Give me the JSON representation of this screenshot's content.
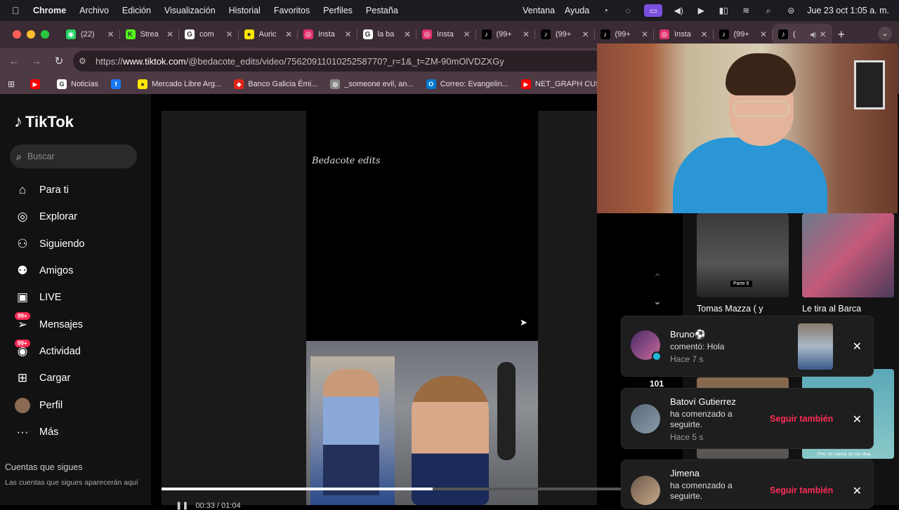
{
  "menubar": {
    "apple": "",
    "items": [
      "Chrome",
      "Archivo",
      "Edición",
      "Visualización",
      "Historial",
      "Favoritos",
      "Perfiles",
      "Pestaña"
    ],
    "right_items": [
      "Ventana",
      "Ayuda"
    ],
    "datetime": "Jue 23 oct  1:05 a. m."
  },
  "tabs": [
    {
      "title": "(22)",
      "icon": "whatsapp-icon",
      "color": "#25d366",
      "glyph": "◉"
    },
    {
      "title": "Strea",
      "icon": "kick-icon",
      "color": "#53fc18",
      "glyph": "K"
    },
    {
      "title": "com",
      "icon": "google-icon",
      "color": "#ffffff",
      "glyph": "G"
    },
    {
      "title": "Auric",
      "icon": "mercadolibre-icon",
      "color": "#ffe600",
      "glyph": "●"
    },
    {
      "title": "Insta",
      "icon": "instagram-icon",
      "color": "#e1306c",
      "glyph": "◎"
    },
    {
      "title": "la ba",
      "icon": "google-icon",
      "color": "#ffffff",
      "glyph": "G"
    },
    {
      "title": "Insta",
      "icon": "instagram-icon",
      "color": "#e1306c",
      "glyph": "◎"
    },
    {
      "title": "(99+",
      "icon": "tiktok-icon",
      "color": "#000000",
      "glyph": "♪"
    },
    {
      "title": "(99+",
      "icon": "tiktok-icon",
      "color": "#000000",
      "glyph": "♪"
    },
    {
      "title": "(99+",
      "icon": "tiktok-icon",
      "color": "#000000",
      "glyph": "♪"
    },
    {
      "title": "Insta",
      "icon": "instagram-icon",
      "color": "#e1306c",
      "glyph": "◎"
    },
    {
      "title": "(99+",
      "icon": "tiktok-icon",
      "color": "#000000",
      "glyph": "♪"
    },
    {
      "title": "(",
      "icon": "tiktok-icon",
      "color": "#000000",
      "glyph": "♪",
      "active": true
    }
  ],
  "address": {
    "prefix": "https://",
    "host": "www.tiktok.com",
    "path": "/@bedacote_edits/video/7562091101025258770?_r=1&_t=ZM-90mOlVDZXGy"
  },
  "bookmarks": [
    {
      "label": "",
      "icon": "youtube-icon",
      "color": "#ff0000",
      "glyph": "▶"
    },
    {
      "label": "Noticias",
      "icon": "google-icon",
      "color": "#ffffff",
      "glyph": "G"
    },
    {
      "label": "",
      "icon": "facebook-icon",
      "color": "#1877f2",
      "glyph": "f"
    },
    {
      "label": "Mercado Libre Arg...",
      "icon": "mercadolibre-icon",
      "color": "#ffe600",
      "glyph": "●"
    },
    {
      "label": "Banco Galicia Émi...",
      "icon": "galicia-icon",
      "color": "#e2231a",
      "glyph": "◆"
    },
    {
      "label": "_someone evil, an...",
      "icon": "globe-icon",
      "color": "#888888",
      "glyph": "◍"
    },
    {
      "label": "Correo: Evangelin...",
      "icon": "outlook-icon",
      "color": "#0078d4",
      "glyph": "O"
    },
    {
      "label": "NET_GRAPH CUS...",
      "icon": "youtube-icon",
      "color": "#ff0000",
      "glyph": "▶"
    }
  ],
  "sidebar": {
    "brand": "TikTok",
    "search_placeholder": "Buscar",
    "nav": [
      {
        "label": "Para ti",
        "icon": "home-icon",
        "glyph": "⌂"
      },
      {
        "label": "Explorar",
        "icon": "compass-icon",
        "glyph": "◎"
      },
      {
        "label": "Siguiendo",
        "icon": "following-icon",
        "glyph": "⚇"
      },
      {
        "label": "Amigos",
        "icon": "friends-icon",
        "glyph": "⚉"
      },
      {
        "label": "LIVE",
        "icon": "live-icon",
        "glyph": "▣"
      },
      {
        "label": "Mensajes",
        "icon": "messages-icon",
        "glyph": "➢",
        "badge": "99+"
      },
      {
        "label": "Actividad",
        "icon": "activity-icon",
        "glyph": "◉",
        "badge": "99+"
      },
      {
        "label": "Cargar",
        "icon": "upload-icon",
        "glyph": "⊞"
      },
      {
        "label": "Perfil",
        "icon": "profile-avatar-icon",
        "glyph": ""
      },
      {
        "label": "Más",
        "icon": "more-icon",
        "glyph": "···"
      }
    ],
    "following_title": "Cuentas que sigues",
    "following_sub": "Las cuentas que sigues aparecerán aquí"
  },
  "video": {
    "overlay_text": "Bedacote edits",
    "timecode": "00:33 / 01:04",
    "progress": 0.59,
    "like_count": "101"
  },
  "related": [
    {
      "title": "Tomas Mazza ( y",
      "tag": "Parte 6"
    },
    {
      "title": "Le tira al Barca",
      "tag": ""
    },
    {
      "title": "",
      "tag": ""
    },
    {
      "title": "",
      "tag": "Pov: mi mamá no me deja"
    }
  ],
  "notifications": [
    {
      "name": "Bruno⚽",
      "line1": "comentó: Hola",
      "line2": "",
      "time": "Hace 7 s",
      "action": ""
    },
    {
      "name": "Batoví Gutierrez",
      "line1": "ha comenzado a",
      "line2": "seguirte.",
      "time": "Hace 5 s",
      "action": "Seguir también"
    },
    {
      "name": "Jimena",
      "line1": "ha comenzado a",
      "line2": "seguirte.",
      "time": "",
      "action": "Seguir también"
    }
  ],
  "colors": {
    "accent": "#fe2c55",
    "tab_strip": "#3b2b34",
    "toolbar": "#4e3a45"
  }
}
